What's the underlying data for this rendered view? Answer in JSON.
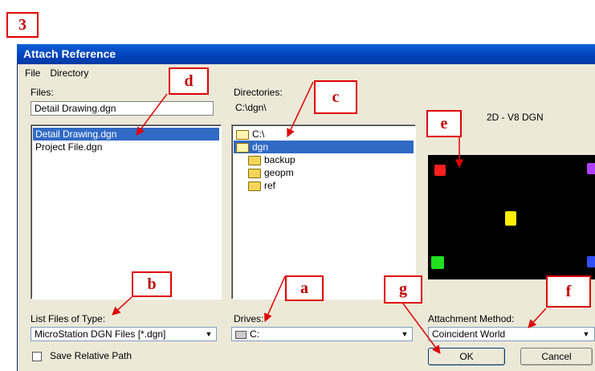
{
  "step_label": "3",
  "dialog": {
    "title": "Attach Reference",
    "menu": [
      "File",
      "Directory"
    ],
    "files_label": "Files:",
    "file_name_value": "Detail Drawing.dgn",
    "files": [
      "Detail Drawing.dgn",
      "Project File.dgn"
    ],
    "directories_label": "Directories:",
    "current_dir": "C:\\dgn\\",
    "directories": [
      "C:\\",
      "dgn",
      "backup",
      "geopm",
      "ref"
    ],
    "preview_label": "2D - V8 DGN",
    "list_type_label": "List Files of Type:",
    "list_type_value": "MicroStation DGN Files [*.dgn]",
    "drives_label": "Drives:",
    "drive_value": "C:",
    "attachment_method_label": "Attachment Method:",
    "attachment_method_value": "Coincident World",
    "save_relative_label": "Save Relative Path",
    "ok_label": "OK",
    "cancel_label": "Cancel"
  },
  "callouts": [
    "a",
    "b",
    "c",
    "d",
    "e",
    "f",
    "g"
  ],
  "colors": {
    "callout": "#e00000",
    "title_bar": "#0a5fd8",
    "selection": "#316ac5",
    "dialog_bg": "#ece9d8"
  }
}
